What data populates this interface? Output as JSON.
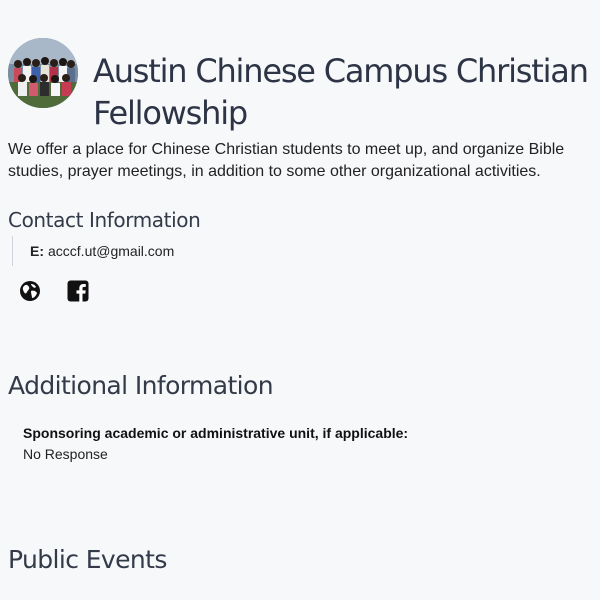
{
  "org": {
    "title": "Austin Chinese Campus Christian Fellowship",
    "description": "We offer a place for Chinese Christian students to meet up, and organize Bible studies, prayer meetings, in addition to some other organizational activities."
  },
  "contact": {
    "heading": "Contact Information",
    "email_label": "E:",
    "email": "acccf.ut@gmail.com",
    "social_icons": [
      "globe-icon",
      "facebook-icon"
    ]
  },
  "additional": {
    "heading": "Additional Information",
    "sponsor_label": "Sponsoring academic or administrative unit, if applicable:",
    "sponsor_value": "No Response"
  },
  "events": {
    "heading": "Public Events"
  }
}
